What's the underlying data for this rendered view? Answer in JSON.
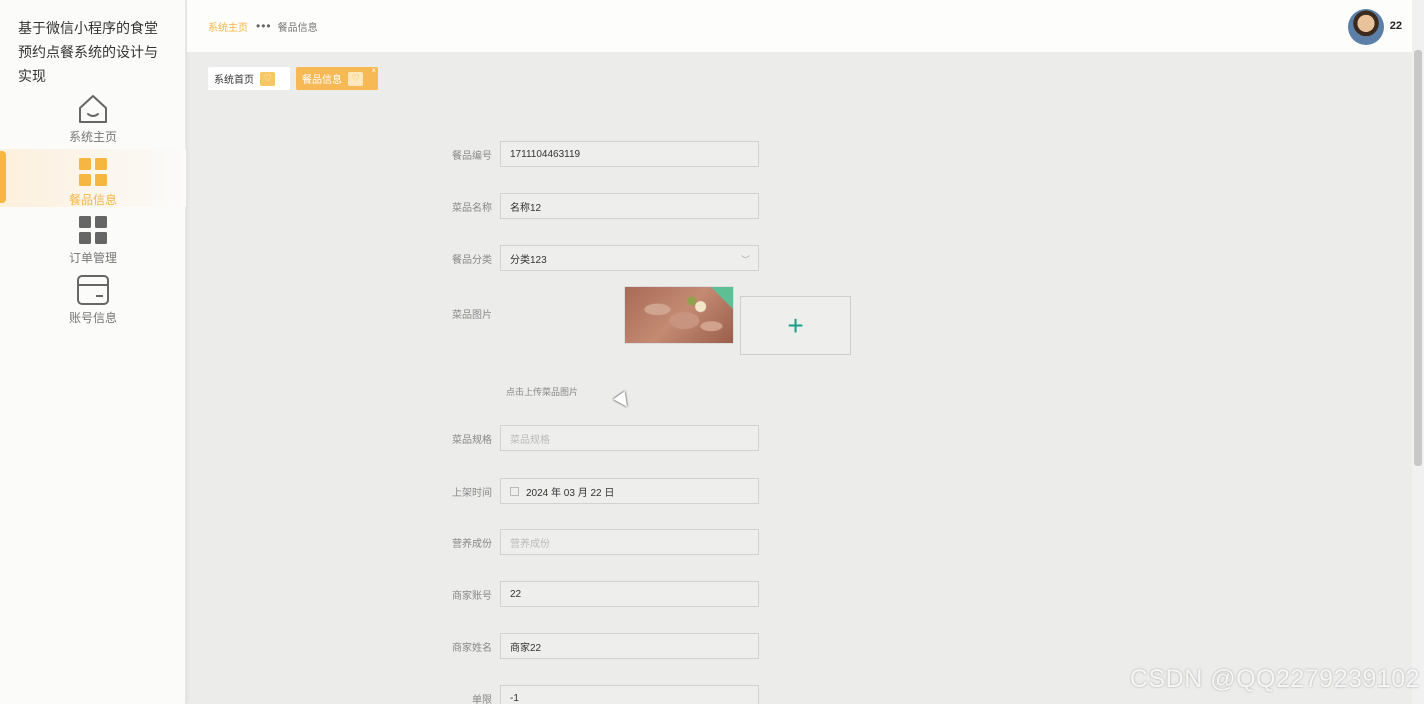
{
  "app": {
    "title": "基于微信小程序的食堂预约点餐系统的设计与实现"
  },
  "sidebar": {
    "items": [
      {
        "label": "系统主页",
        "icon": "home-icon"
      },
      {
        "label": "餐品信息",
        "icon": "grid-icon",
        "active": true
      },
      {
        "label": "订单管理",
        "icon": "grid-icon"
      },
      {
        "label": "账号信息",
        "icon": "card-icon"
      }
    ]
  },
  "header": {
    "breadcrumb_home": "系统主页",
    "breadcrumb_sep": "•••",
    "breadcrumb_current": "餐品信息",
    "username": "22"
  },
  "tabs": [
    {
      "label": "系统首页",
      "icon": "heart-icon"
    },
    {
      "label": "餐品信息",
      "icon": "heart-icon",
      "active": true,
      "close": "×"
    }
  ],
  "form": {
    "code": {
      "label": "餐品编号",
      "value": "1711104463119"
    },
    "name": {
      "label": "菜品名称",
      "value": "名称12"
    },
    "category": {
      "label": "餐品分类",
      "value": "分类123"
    },
    "photo": {
      "label": "菜品图片",
      "add": "+",
      "hint": "点击上传菜品图片"
    },
    "spec": {
      "label": "菜品规格",
      "placeholder": "菜品规格"
    },
    "date": {
      "label": "上架时间",
      "value": "2024 年 03 月 22 日"
    },
    "nutrition": {
      "label": "营养成份",
      "placeholder": "营养成份"
    },
    "merchant_account": {
      "label": "商家账号",
      "value": "22"
    },
    "merchant_name": {
      "label": "商家姓名",
      "value": "商家22"
    },
    "limit": {
      "label": "单限",
      "value": "-1"
    }
  },
  "watermark": "CSDN @QQ2279239102",
  "colors": {
    "accent": "#f5b642",
    "plus": "#16a085"
  }
}
